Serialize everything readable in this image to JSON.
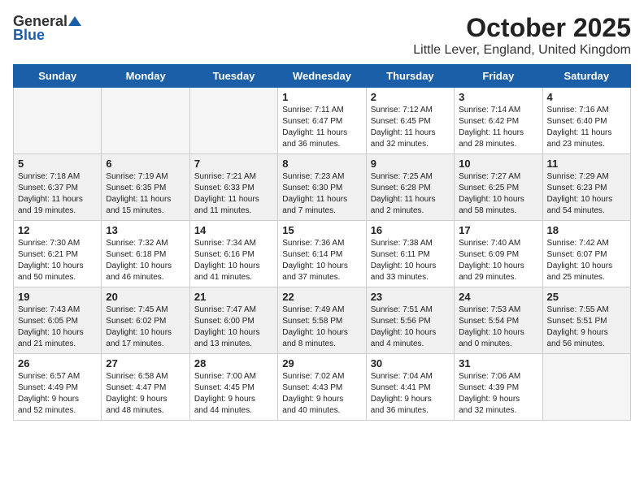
{
  "logo": {
    "general": "General",
    "blue": "Blue"
  },
  "title": "October 2025",
  "location": "Little Lever, England, United Kingdom",
  "headers": [
    "Sunday",
    "Monday",
    "Tuesday",
    "Wednesday",
    "Thursday",
    "Friday",
    "Saturday"
  ],
  "weeks": [
    [
      {
        "day": "",
        "info": "",
        "empty": true
      },
      {
        "day": "",
        "info": "",
        "empty": true
      },
      {
        "day": "",
        "info": "",
        "empty": true
      },
      {
        "day": "1",
        "info": "Sunrise: 7:11 AM\nSunset: 6:47 PM\nDaylight: 11 hours\nand 36 minutes."
      },
      {
        "day": "2",
        "info": "Sunrise: 7:12 AM\nSunset: 6:45 PM\nDaylight: 11 hours\nand 32 minutes."
      },
      {
        "day": "3",
        "info": "Sunrise: 7:14 AM\nSunset: 6:42 PM\nDaylight: 11 hours\nand 28 minutes."
      },
      {
        "day": "4",
        "info": "Sunrise: 7:16 AM\nSunset: 6:40 PM\nDaylight: 11 hours\nand 23 minutes."
      }
    ],
    [
      {
        "day": "5",
        "info": "Sunrise: 7:18 AM\nSunset: 6:37 PM\nDaylight: 11 hours\nand 19 minutes."
      },
      {
        "day": "6",
        "info": "Sunrise: 7:19 AM\nSunset: 6:35 PM\nDaylight: 11 hours\nand 15 minutes."
      },
      {
        "day": "7",
        "info": "Sunrise: 7:21 AM\nSunset: 6:33 PM\nDaylight: 11 hours\nand 11 minutes."
      },
      {
        "day": "8",
        "info": "Sunrise: 7:23 AM\nSunset: 6:30 PM\nDaylight: 11 hours\nand 7 minutes."
      },
      {
        "day": "9",
        "info": "Sunrise: 7:25 AM\nSunset: 6:28 PM\nDaylight: 11 hours\nand 2 minutes."
      },
      {
        "day": "10",
        "info": "Sunrise: 7:27 AM\nSunset: 6:25 PM\nDaylight: 10 hours\nand 58 minutes."
      },
      {
        "day": "11",
        "info": "Sunrise: 7:29 AM\nSunset: 6:23 PM\nDaylight: 10 hours\nand 54 minutes."
      }
    ],
    [
      {
        "day": "12",
        "info": "Sunrise: 7:30 AM\nSunset: 6:21 PM\nDaylight: 10 hours\nand 50 minutes."
      },
      {
        "day": "13",
        "info": "Sunrise: 7:32 AM\nSunset: 6:18 PM\nDaylight: 10 hours\nand 46 minutes."
      },
      {
        "day": "14",
        "info": "Sunrise: 7:34 AM\nSunset: 6:16 PM\nDaylight: 10 hours\nand 41 minutes."
      },
      {
        "day": "15",
        "info": "Sunrise: 7:36 AM\nSunset: 6:14 PM\nDaylight: 10 hours\nand 37 minutes."
      },
      {
        "day": "16",
        "info": "Sunrise: 7:38 AM\nSunset: 6:11 PM\nDaylight: 10 hours\nand 33 minutes."
      },
      {
        "day": "17",
        "info": "Sunrise: 7:40 AM\nSunset: 6:09 PM\nDaylight: 10 hours\nand 29 minutes."
      },
      {
        "day": "18",
        "info": "Sunrise: 7:42 AM\nSunset: 6:07 PM\nDaylight: 10 hours\nand 25 minutes."
      }
    ],
    [
      {
        "day": "19",
        "info": "Sunrise: 7:43 AM\nSunset: 6:05 PM\nDaylight: 10 hours\nand 21 minutes."
      },
      {
        "day": "20",
        "info": "Sunrise: 7:45 AM\nSunset: 6:02 PM\nDaylight: 10 hours\nand 17 minutes."
      },
      {
        "day": "21",
        "info": "Sunrise: 7:47 AM\nSunset: 6:00 PM\nDaylight: 10 hours\nand 13 minutes."
      },
      {
        "day": "22",
        "info": "Sunrise: 7:49 AM\nSunset: 5:58 PM\nDaylight: 10 hours\nand 8 minutes."
      },
      {
        "day": "23",
        "info": "Sunrise: 7:51 AM\nSunset: 5:56 PM\nDaylight: 10 hours\nand 4 minutes."
      },
      {
        "day": "24",
        "info": "Sunrise: 7:53 AM\nSunset: 5:54 PM\nDaylight: 10 hours\nand 0 minutes."
      },
      {
        "day": "25",
        "info": "Sunrise: 7:55 AM\nSunset: 5:51 PM\nDaylight: 9 hours\nand 56 minutes."
      }
    ],
    [
      {
        "day": "26",
        "info": "Sunrise: 6:57 AM\nSunset: 4:49 PM\nDaylight: 9 hours\nand 52 minutes."
      },
      {
        "day": "27",
        "info": "Sunrise: 6:58 AM\nSunset: 4:47 PM\nDaylight: 9 hours\nand 48 minutes."
      },
      {
        "day": "28",
        "info": "Sunrise: 7:00 AM\nSunset: 4:45 PM\nDaylight: 9 hours\nand 44 minutes."
      },
      {
        "day": "29",
        "info": "Sunrise: 7:02 AM\nSunset: 4:43 PM\nDaylight: 9 hours\nand 40 minutes."
      },
      {
        "day": "30",
        "info": "Sunrise: 7:04 AM\nSunset: 4:41 PM\nDaylight: 9 hours\nand 36 minutes."
      },
      {
        "day": "31",
        "info": "Sunrise: 7:06 AM\nSunset: 4:39 PM\nDaylight: 9 hours\nand 32 minutes."
      },
      {
        "day": "",
        "info": "",
        "empty": true
      }
    ]
  ]
}
